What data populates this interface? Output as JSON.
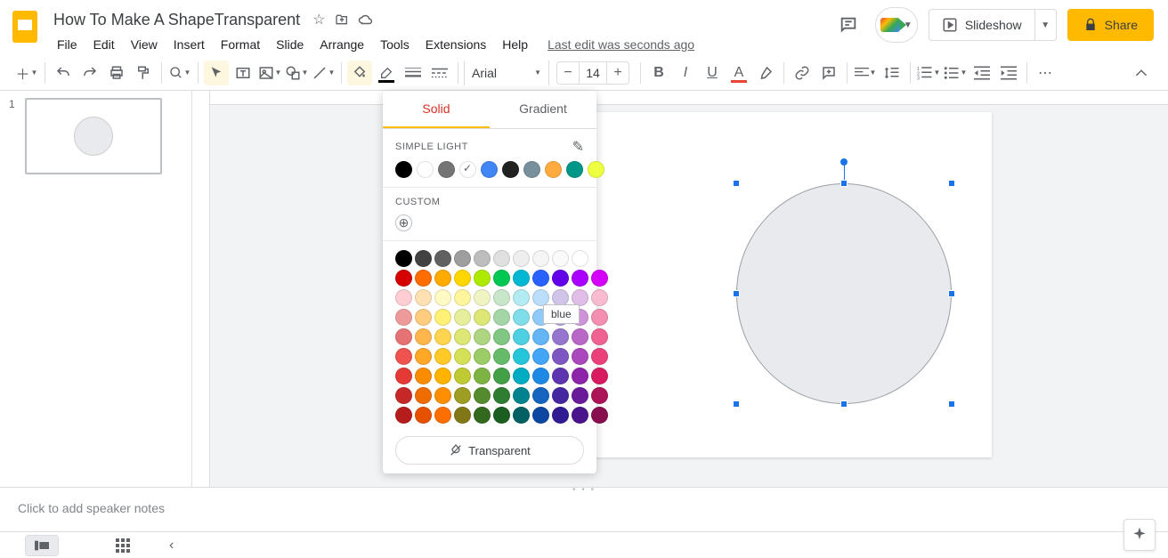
{
  "doc": {
    "title": "How To Make A ShapeTransparent",
    "last_edit": "Last edit was seconds ago"
  },
  "menus": {
    "file": "File",
    "edit": "Edit",
    "view": "View",
    "insert": "Insert",
    "format": "Format",
    "slide": "Slide",
    "arrange": "Arrange",
    "tools": "Tools",
    "extensions": "Extensions",
    "help": "Help"
  },
  "header": {
    "slideshow": "Slideshow",
    "share": "Share"
  },
  "toolbar": {
    "font": "Arial",
    "font_size": "14"
  },
  "thumbnails": [
    {
      "num": "1"
    }
  ],
  "color_picker": {
    "tab_solid": "Solid",
    "tab_gradient": "Gradient",
    "theme_label": "SIMPLE LIGHT",
    "custom_label": "CUSTOM",
    "transparent": "Transparent",
    "tooltip": "blue",
    "theme_colors": [
      "#000000",
      "#ffffff",
      "#757575",
      "#ffffff",
      "#4285f4",
      "#212121",
      "#78909c",
      "#ffab40",
      "#009688",
      "#eeff41"
    ],
    "theme_checked_index": 3,
    "grid": [
      [
        "#000000",
        "#424242",
        "#616161",
        "#9e9e9e",
        "#bdbdbd",
        "#e0e0e0",
        "#eeeeee",
        "#f5f5f5",
        "#fafafa",
        "#ffffff"
      ],
      [
        "#d50000",
        "#ff6d00",
        "#ffab00",
        "#ffd600",
        "#aeea00",
        "#00c853",
        "#00b8d4",
        "#2962ff",
        "#6200ea",
        "#aa00ff",
        "#d500f9"
      ],
      [
        "#ffcdd2",
        "#ffe0b2",
        "#fff9c4",
        "#fff59d",
        "#f0f4c3",
        "#c8e6c9",
        "#b2ebf2",
        "#bbdefb",
        "#d1c4e9",
        "#e1bee7",
        "#f8bbd0"
      ],
      [
        "#ef9a9a",
        "#ffcc80",
        "#fff176",
        "#e6ee9c",
        "#dce775",
        "#a5d6a7",
        "#80deea",
        "#90caf9",
        "#b39ddb",
        "#ce93d8",
        "#f48fb1"
      ],
      [
        "#e57373",
        "#ffb74d",
        "#ffd54f",
        "#dce775",
        "#aed581",
        "#81c784",
        "#4dd0e1",
        "#64b5f6",
        "#9575cd",
        "#ba68c8",
        "#f06292"
      ],
      [
        "#ef5350",
        "#ffa726",
        "#ffca28",
        "#d4e157",
        "#9ccc65",
        "#66bb6a",
        "#26c6da",
        "#42a5f5",
        "#7e57c2",
        "#ab47bc",
        "#ec407a"
      ],
      [
        "#e53935",
        "#fb8c00",
        "#ffb300",
        "#c0ca33",
        "#7cb342",
        "#43a047",
        "#00acc1",
        "#1e88e5",
        "#5e35b1",
        "#8e24aa",
        "#d81b60"
      ],
      [
        "#c62828",
        "#ef6c00",
        "#ff8f00",
        "#9e9d24",
        "#558b2f",
        "#2e7d32",
        "#00838f",
        "#1565c0",
        "#4527a0",
        "#6a1b9a",
        "#ad1457"
      ],
      [
        "#b71c1c",
        "#e65100",
        "#ff6f00",
        "#827717",
        "#33691e",
        "#1b5e20",
        "#006064",
        "#0d47a1",
        "#311b92",
        "#4a148c",
        "#880e4f"
      ]
    ]
  },
  "notes": {
    "placeholder": "Click to add speaker notes"
  }
}
